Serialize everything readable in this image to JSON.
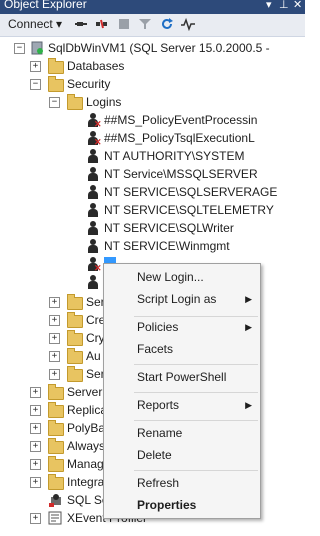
{
  "window": {
    "title": "Object Explorer"
  },
  "toolbar": {
    "connect_label": "Connect ▾"
  },
  "tree": {
    "server": "SqlDbWinVM1 (SQL Server 15.0.2000.5 -",
    "databases": "Databases",
    "security": "Security",
    "logins": "Logins",
    "login_items": [
      "##MS_PolicyEventProcessin",
      "##MS_PolicyTsqlExecutionL",
      "NT AUTHORITY\\SYSTEM",
      "NT Service\\MSSQLSERVER",
      "NT SERVICE\\SQLSERVERAGE",
      "NT SERVICE\\SQLTELEMETRY",
      "NT SERVICE\\SQLWriter",
      "NT SERVICE\\Winmgmt"
    ],
    "partial_folders": [
      "Ser",
      "Cre",
      "Cry",
      "Au",
      "Ser"
    ],
    "partial_nodes": [
      "Server",
      "Replica",
      "PolyBa",
      "Always",
      "Manag",
      "Integra",
      "SQL Se"
    ],
    "xevent": "XEvent Profiler"
  },
  "context_menu": {
    "items": [
      {
        "label": "New Login...",
        "submenu": false
      },
      {
        "label": "Script Login as",
        "submenu": true
      },
      {
        "label": "Policies",
        "submenu": true
      },
      {
        "label": "Facets",
        "submenu": false
      },
      {
        "label": "Start PowerShell",
        "submenu": false
      },
      {
        "label": "Reports",
        "submenu": true
      },
      {
        "label": "Rename",
        "submenu": false
      },
      {
        "label": "Delete",
        "submenu": false
      },
      {
        "label": "Refresh",
        "submenu": false
      },
      {
        "label": "Properties",
        "submenu": false
      }
    ]
  },
  "colors": {
    "titlebar": "#2d4a7a",
    "toolbar": "#e9ecf2",
    "selection": "#3399ff",
    "folder": "#e8c461"
  }
}
